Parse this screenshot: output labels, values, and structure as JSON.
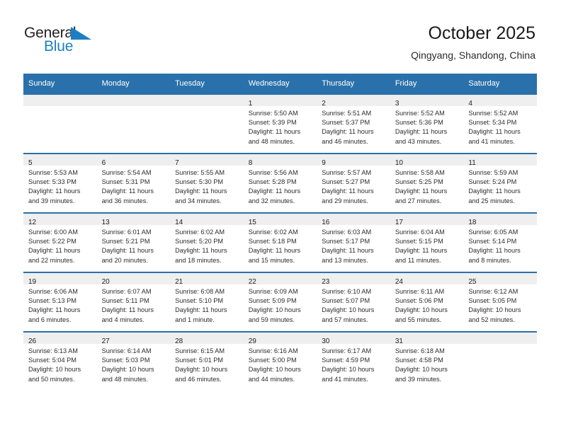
{
  "brand": {
    "name_part1": "General",
    "name_part2": "Blue",
    "flag_icon": "blue-triangle-flag-icon",
    "accent_color": "#1b7fc3"
  },
  "header": {
    "title": "October 2025",
    "subtitle": "Qingyang, Shandong, China"
  },
  "theme": {
    "header_blue": "#2a71ab",
    "daynum_band": "#efefef",
    "cell_background": "#ffffff",
    "text_color": "#2c2c2c"
  },
  "calendar": {
    "weekday_headers": [
      "Sunday",
      "Monday",
      "Tuesday",
      "Wednesday",
      "Thursday",
      "Friday",
      "Saturday"
    ],
    "weeks": [
      [
        {
          "day": "",
          "empty": true,
          "lines": []
        },
        {
          "day": "",
          "empty": true,
          "lines": []
        },
        {
          "day": "",
          "empty": true,
          "lines": []
        },
        {
          "day": "1",
          "empty": false,
          "lines": [
            "Sunrise: 5:50 AM",
            "Sunset: 5:39 PM",
            "Daylight: 11 hours",
            "and 48 minutes."
          ]
        },
        {
          "day": "2",
          "empty": false,
          "lines": [
            "Sunrise: 5:51 AM",
            "Sunset: 5:37 PM",
            "Daylight: 11 hours",
            "and 46 minutes."
          ]
        },
        {
          "day": "3",
          "empty": false,
          "lines": [
            "Sunrise: 5:52 AM",
            "Sunset: 5:36 PM",
            "Daylight: 11 hours",
            "and 43 minutes."
          ]
        },
        {
          "day": "4",
          "empty": false,
          "lines": [
            "Sunrise: 5:52 AM",
            "Sunset: 5:34 PM",
            "Daylight: 11 hours",
            "and 41 minutes."
          ]
        }
      ],
      [
        {
          "day": "5",
          "empty": false,
          "lines": [
            "Sunrise: 5:53 AM",
            "Sunset: 5:33 PM",
            "Daylight: 11 hours",
            "and 39 minutes."
          ]
        },
        {
          "day": "6",
          "empty": false,
          "lines": [
            "Sunrise: 5:54 AM",
            "Sunset: 5:31 PM",
            "Daylight: 11 hours",
            "and 36 minutes."
          ]
        },
        {
          "day": "7",
          "empty": false,
          "lines": [
            "Sunrise: 5:55 AM",
            "Sunset: 5:30 PM",
            "Daylight: 11 hours",
            "and 34 minutes."
          ]
        },
        {
          "day": "8",
          "empty": false,
          "lines": [
            "Sunrise: 5:56 AM",
            "Sunset: 5:28 PM",
            "Daylight: 11 hours",
            "and 32 minutes."
          ]
        },
        {
          "day": "9",
          "empty": false,
          "lines": [
            "Sunrise: 5:57 AM",
            "Sunset: 5:27 PM",
            "Daylight: 11 hours",
            "and 29 minutes."
          ]
        },
        {
          "day": "10",
          "empty": false,
          "lines": [
            "Sunrise: 5:58 AM",
            "Sunset: 5:25 PM",
            "Daylight: 11 hours",
            "and 27 minutes."
          ]
        },
        {
          "day": "11",
          "empty": false,
          "lines": [
            "Sunrise: 5:59 AM",
            "Sunset: 5:24 PM",
            "Daylight: 11 hours",
            "and 25 minutes."
          ]
        }
      ],
      [
        {
          "day": "12",
          "empty": false,
          "lines": [
            "Sunrise: 6:00 AM",
            "Sunset: 5:22 PM",
            "Daylight: 11 hours",
            "and 22 minutes."
          ]
        },
        {
          "day": "13",
          "empty": false,
          "lines": [
            "Sunrise: 6:01 AM",
            "Sunset: 5:21 PM",
            "Daylight: 11 hours",
            "and 20 minutes."
          ]
        },
        {
          "day": "14",
          "empty": false,
          "lines": [
            "Sunrise: 6:02 AM",
            "Sunset: 5:20 PM",
            "Daylight: 11 hours",
            "and 18 minutes."
          ]
        },
        {
          "day": "15",
          "empty": false,
          "lines": [
            "Sunrise: 6:02 AM",
            "Sunset: 5:18 PM",
            "Daylight: 11 hours",
            "and 15 minutes."
          ]
        },
        {
          "day": "16",
          "empty": false,
          "lines": [
            "Sunrise: 6:03 AM",
            "Sunset: 5:17 PM",
            "Daylight: 11 hours",
            "and 13 minutes."
          ]
        },
        {
          "day": "17",
          "empty": false,
          "lines": [
            "Sunrise: 6:04 AM",
            "Sunset: 5:15 PM",
            "Daylight: 11 hours",
            "and 11 minutes."
          ]
        },
        {
          "day": "18",
          "empty": false,
          "lines": [
            "Sunrise: 6:05 AM",
            "Sunset: 5:14 PM",
            "Daylight: 11 hours",
            "and 8 minutes."
          ]
        }
      ],
      [
        {
          "day": "19",
          "empty": false,
          "lines": [
            "Sunrise: 6:06 AM",
            "Sunset: 5:13 PM",
            "Daylight: 11 hours",
            "and 6 minutes."
          ]
        },
        {
          "day": "20",
          "empty": false,
          "lines": [
            "Sunrise: 6:07 AM",
            "Sunset: 5:11 PM",
            "Daylight: 11 hours",
            "and 4 minutes."
          ]
        },
        {
          "day": "21",
          "empty": false,
          "lines": [
            "Sunrise: 6:08 AM",
            "Sunset: 5:10 PM",
            "Daylight: 11 hours",
            "and 1 minute."
          ]
        },
        {
          "day": "22",
          "empty": false,
          "lines": [
            "Sunrise: 6:09 AM",
            "Sunset: 5:09 PM",
            "Daylight: 10 hours",
            "and 59 minutes."
          ]
        },
        {
          "day": "23",
          "empty": false,
          "lines": [
            "Sunrise: 6:10 AM",
            "Sunset: 5:07 PM",
            "Daylight: 10 hours",
            "and 57 minutes."
          ]
        },
        {
          "day": "24",
          "empty": false,
          "lines": [
            "Sunrise: 6:11 AM",
            "Sunset: 5:06 PM",
            "Daylight: 10 hours",
            "and 55 minutes."
          ]
        },
        {
          "day": "25",
          "empty": false,
          "lines": [
            "Sunrise: 6:12 AM",
            "Sunset: 5:05 PM",
            "Daylight: 10 hours",
            "and 52 minutes."
          ]
        }
      ],
      [
        {
          "day": "26",
          "empty": false,
          "lines": [
            "Sunrise: 6:13 AM",
            "Sunset: 5:04 PM",
            "Daylight: 10 hours",
            "and 50 minutes."
          ]
        },
        {
          "day": "27",
          "empty": false,
          "lines": [
            "Sunrise: 6:14 AM",
            "Sunset: 5:03 PM",
            "Daylight: 10 hours",
            "and 48 minutes."
          ]
        },
        {
          "day": "28",
          "empty": false,
          "lines": [
            "Sunrise: 6:15 AM",
            "Sunset: 5:01 PM",
            "Daylight: 10 hours",
            "and 46 minutes."
          ]
        },
        {
          "day": "29",
          "empty": false,
          "lines": [
            "Sunrise: 6:16 AM",
            "Sunset: 5:00 PM",
            "Daylight: 10 hours",
            "and 44 minutes."
          ]
        },
        {
          "day": "30",
          "empty": false,
          "lines": [
            "Sunrise: 6:17 AM",
            "Sunset: 4:59 PM",
            "Daylight: 10 hours",
            "and 41 minutes."
          ]
        },
        {
          "day": "31",
          "empty": false,
          "lines": [
            "Sunrise: 6:18 AM",
            "Sunset: 4:58 PM",
            "Daylight: 10 hours",
            "and 39 minutes."
          ]
        },
        {
          "day": "",
          "empty": true,
          "lines": []
        }
      ]
    ]
  }
}
